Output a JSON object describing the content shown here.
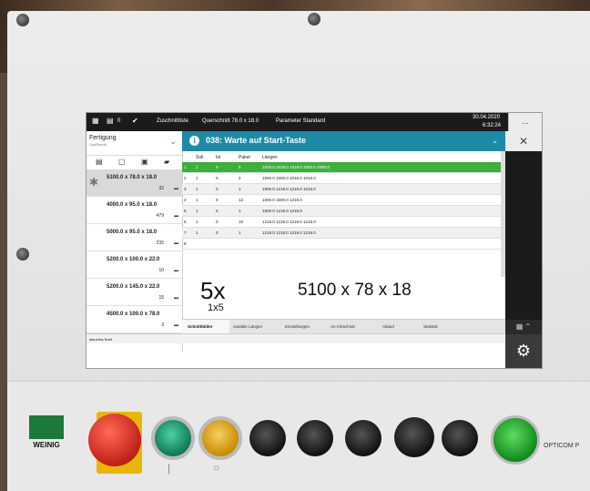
{
  "topbar": {
    "counter": "0",
    "items": [
      "Zuschnittliste",
      "Querschnitt 78.0 x 18.0",
      "Parameter Standard"
    ],
    "date": "30.04.2020",
    "time": "6:32:24",
    "more": "..."
  },
  "sidebar": {
    "title": "Fertigung",
    "subtitle": "OptiResult",
    "jobs": [
      {
        "dim": "5100.0 x 78.0 x 18.0",
        "count": "32"
      },
      {
        "dim": "4000.0 x 95.0 x 18.0",
        "count": "479"
      },
      {
        "dim": "5000.0 x 95.0 x 18.0",
        "count": "235"
      },
      {
        "dim": "5200.0 x 100.0 x 22.0",
        "count": "10"
      },
      {
        "dim": "5200.0 x 145.0 x 22.0",
        "count": "15"
      },
      {
        "dim": "4500.0 x 100.0 x 78.0",
        "count": "3"
      }
    ]
  },
  "header": {
    "title": "038: Warte auf Start-Taste",
    "close": "✕"
  },
  "table": {
    "columns": [
      "Soll",
      "Ist",
      "Paket",
      "Längen"
    ],
    "rows": [
      {
        "n": "1",
        "soll": "1",
        "ist": "0",
        "paket": "5",
        "laengen": "1018.0 1018.0 1018.0 1000.0 1000.0"
      },
      {
        "n": "2",
        "soll": "1",
        "ist": "0",
        "paket": "2",
        "laengen": "1500.0 1500.0 1018.0 1018.0"
      },
      {
        "n": "3",
        "soll": "1",
        "ist": "0",
        "paket": "1",
        "laengen": "1500.0 1218.0 1218.0 1018.0"
      },
      {
        "n": "4",
        "soll": "1",
        "ist": "0",
        "paket": "12",
        "laengen": "1500.0 1500.0 1218.0"
      },
      {
        "n": "5",
        "soll": "1",
        "ist": "0",
        "paket": "1",
        "laengen": "1500.0 1218.0 1218.0"
      },
      {
        "n": "6",
        "soll": "1",
        "ist": "0",
        "paket": "10",
        "laengen": "1218.0 1218.0 1218.0 1218.0"
      },
      {
        "n": "7",
        "soll": "1",
        "ist": "0",
        "paket": "1",
        "laengen": "1218.0 1218.0 1218.0 1218.0"
      },
      {
        "n": "8",
        "soll": "",
        "ist": "",
        "paket": "",
        "laengen": ""
      }
    ]
  },
  "summary": {
    "multiplier": "5x",
    "sub": "1x5",
    "dims": "5100 x 78 x 18"
  },
  "tabs": [
    "Schnittbilder",
    "variable Längen",
    "Einstellungen",
    "An-/Abschnitt",
    "Ablauf",
    "Statistik"
  ],
  "status": "aktuelles Brett",
  "panel": {
    "brand": "WEINIG",
    "model": "OPTICOM P"
  },
  "colors": {
    "accent": "#1d8aa8",
    "selected_row": "#3cb03c"
  }
}
